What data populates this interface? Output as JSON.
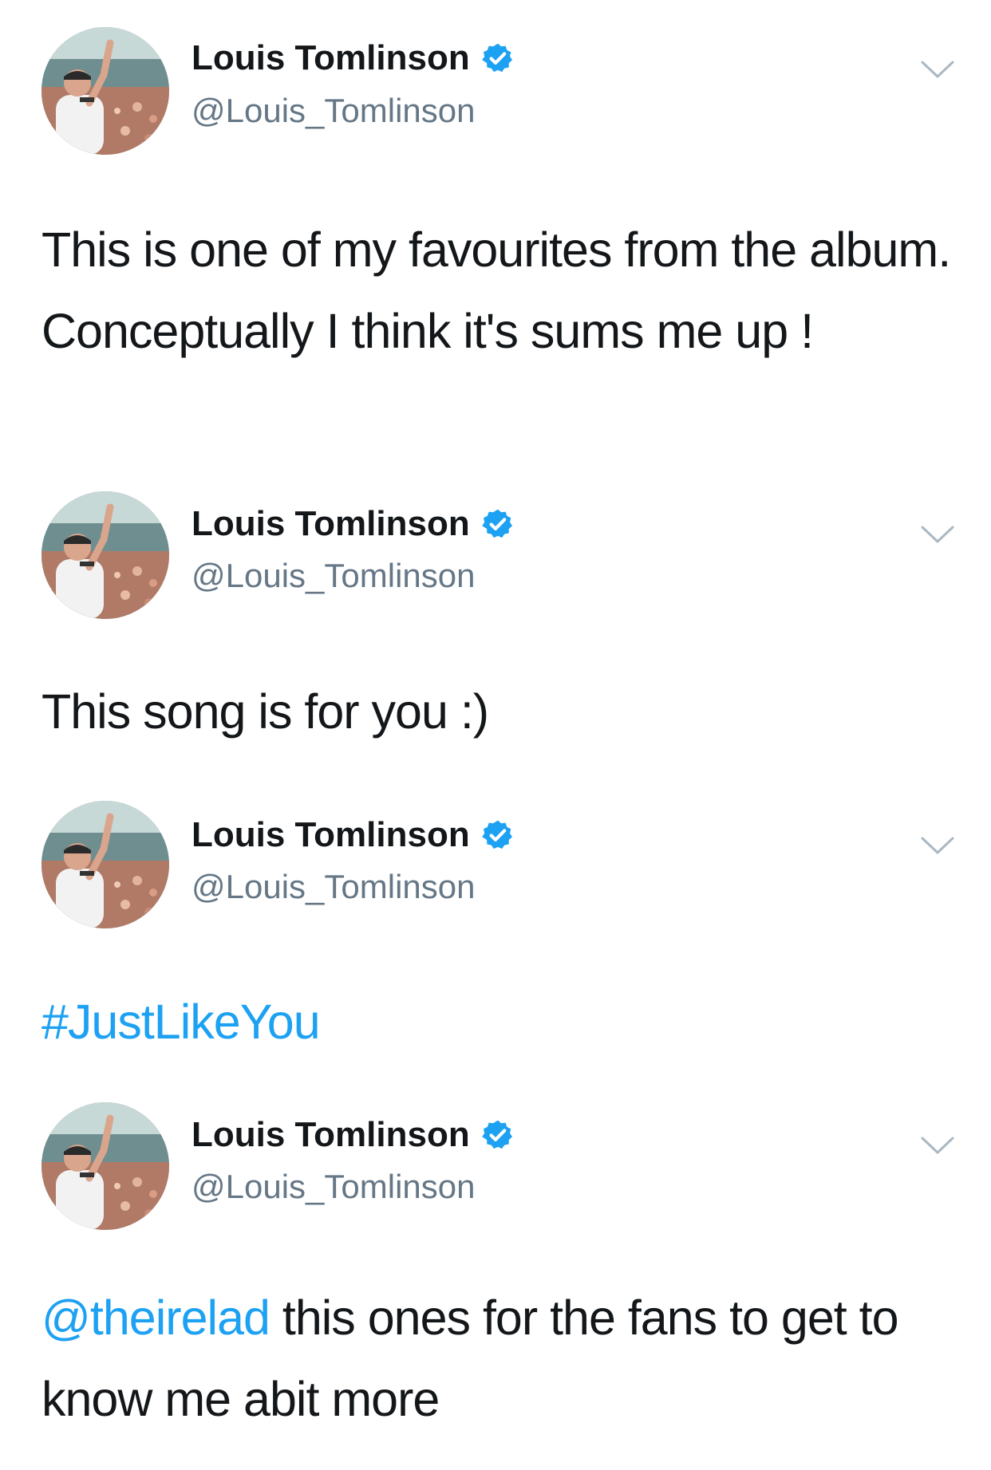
{
  "tweets": [
    {
      "author": {
        "name": "Louis Tomlinson",
        "handle": "@Louis_Tomlinson",
        "verified": true
      },
      "text": "This is one of my favourites from the album. Conceptually I think it's sums me up !"
    },
    {
      "author": {
        "name": "Louis Tomlinson",
        "handle": "@Louis_Tomlinson",
        "verified": true
      },
      "text": "This song is for you :)"
    },
    {
      "author": {
        "name": "Louis Tomlinson",
        "handle": "@Louis_Tomlinson",
        "verified": true
      },
      "hashtag": "#JustLikeYou"
    },
    {
      "author": {
        "name": "Louis Tomlinson",
        "handle": "@Louis_Tomlinson",
        "verified": true
      },
      "mention": "@theirelad",
      "text": " this ones for the fans to get to know me abit more"
    }
  ],
  "icons": {
    "verified": "verified-badge-icon",
    "menu": "chevron-down-icon"
  },
  "colors": {
    "link": "#1da1f2",
    "verified": "#1da1f2",
    "text": "#14171a",
    "secondary": "#657786",
    "chevron": "#aab8c2"
  }
}
